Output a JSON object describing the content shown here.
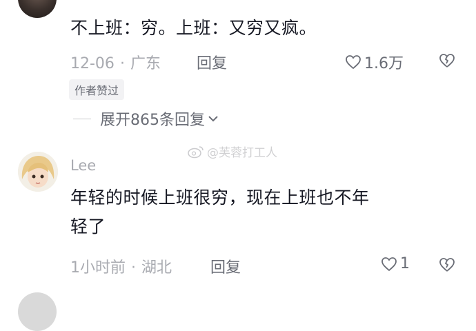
{
  "comment1": {
    "text": "不上班：穷。上班：又穷又疯。",
    "time": "12-06",
    "location": "广东",
    "reply_label": "回复",
    "likes": "1.6万",
    "author_badge": "作者赞过",
    "expand_label": "展开865条回复"
  },
  "watermark": "@芙蓉打工人",
  "comment2": {
    "username": "Lee",
    "text_line1": "年轻的时候上班很穷，现在上班也不年",
    "text_line2": "轻了",
    "time": "1小时前",
    "location": "湖北",
    "reply_label": "回复",
    "likes": "1"
  },
  "colors": {
    "text": "#161823",
    "meta": "#a8aab0",
    "action": "#6a6d76"
  }
}
